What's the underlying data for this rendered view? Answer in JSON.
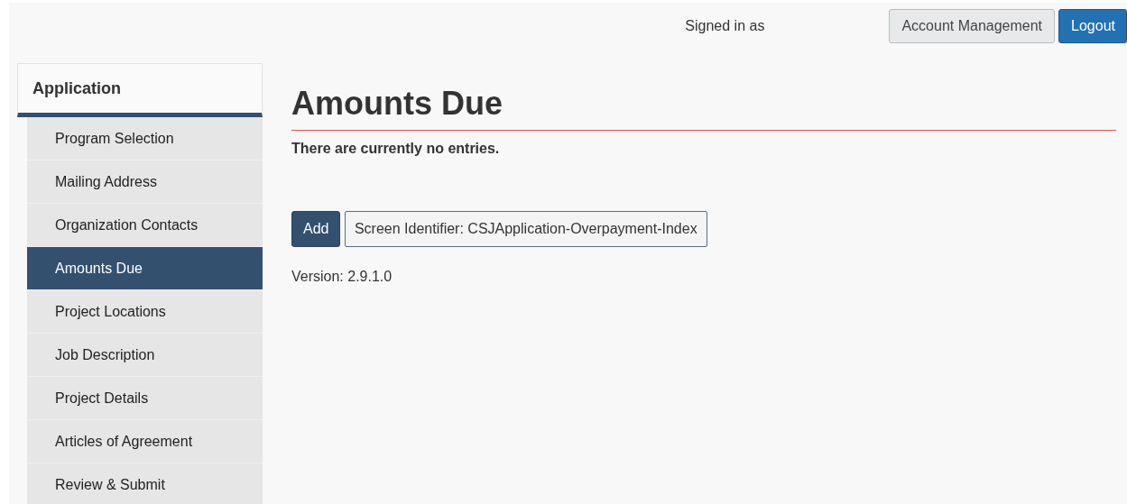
{
  "header": {
    "signed_in_label": "Signed in as",
    "buttons": [
      {
        "label": "Account Management",
        "kind": "secondary"
      },
      {
        "label": "Logout",
        "kind": "primary"
      }
    ]
  },
  "sidebar": {
    "title": "Application",
    "items": [
      {
        "label": "Program Selection",
        "selected": false
      },
      {
        "label": "Mailing Address",
        "selected": false
      },
      {
        "label": "Organization Contacts",
        "selected": false
      },
      {
        "label": "Amounts Due",
        "selected": true
      },
      {
        "label": "Project Locations",
        "selected": false
      },
      {
        "label": "Job Description",
        "selected": false
      },
      {
        "label": "Project Details",
        "selected": false
      },
      {
        "label": "Articles of Agreement",
        "selected": false
      },
      {
        "label": "Review & Submit",
        "selected": false
      }
    ]
  },
  "main": {
    "title": "Amounts Due",
    "message": "There are currently no entries.",
    "add_button": "Add",
    "screen_identifier": "Screen Identifier: CSJApplication-Overpayment-Index",
    "version": "Version: 2.9.1.0"
  }
}
